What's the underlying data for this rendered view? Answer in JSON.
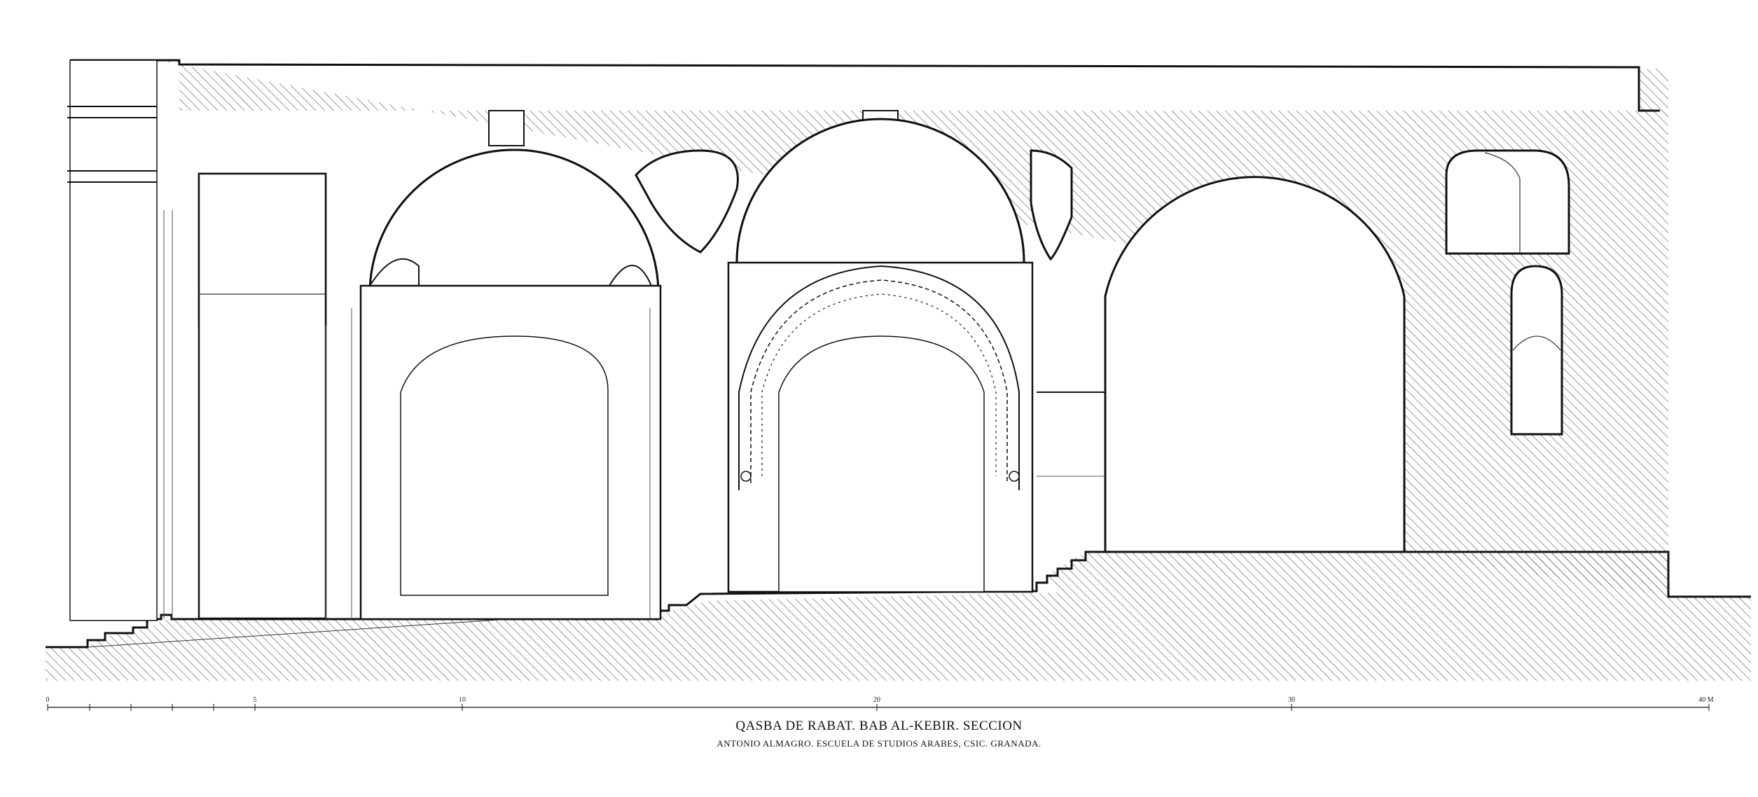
{
  "title": "QASBA DE RABAT. BAB AL-KEBIR. SECCION",
  "subtitle": "ANTONIO ALMAGRO. ESCUELA DE STUDIOS ARABES, CSIC. GRANADA.",
  "scale": {
    "labels": [
      "0",
      "5",
      "10",
      "20",
      "30",
      "40 M"
    ],
    "values": [
      0,
      5,
      10,
      20,
      30,
      40
    ]
  },
  "colors": {
    "ink": "#111111",
    "paper": "#ffffff"
  }
}
